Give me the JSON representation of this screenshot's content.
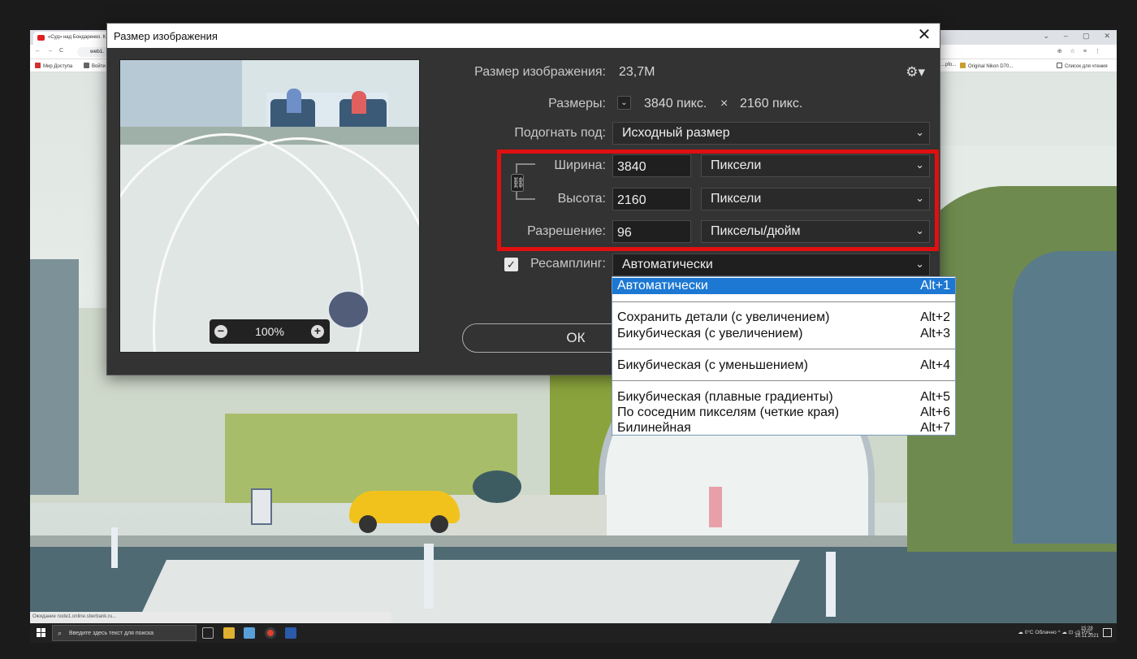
{
  "browser": {
    "tab1_title": "«Суд» над Бондаренко. К",
    "url_fragment": "web1.",
    "bookmarks": [
      "Мир Доступа",
      "Войти"
    ],
    "bookmarks_right": [
      "...pfo...",
      "Original Nikon D70...",
      "Список для чтения"
    ],
    "status_url": "Ожидание node1.online.sberbank.ru..."
  },
  "taskbar": {
    "search_placeholder": "Введите здесь текст для поиска",
    "weather": "0°C Облачно",
    "lang": "РУС",
    "time": "15:28",
    "date": "10.11.2021"
  },
  "dialog": {
    "title": "Размер изображения",
    "close_label": "✕",
    "image_size_label": "Размер изображения:",
    "image_size_value": "23,7M",
    "dimensions_label": "Размеры:",
    "dimensions_w": "3840 пикс.",
    "dimensions_x": "×",
    "dimensions_h": "2160 пикс.",
    "fit_label": "Подогнать под:",
    "fit_value": "Исходный размер",
    "width_label": "Ширина:",
    "width_value": "3840",
    "width_unit": "Пиксели",
    "height_label": "Высота:",
    "height_value": "2160",
    "height_unit": "Пиксели",
    "resolution_label": "Разрешение:",
    "resolution_value": "96",
    "resolution_unit": "Пикселы/дюйм",
    "resample_label": "Ресамплинг:",
    "resample_value": "Автоматически",
    "resample_checked": true,
    "ok_label": "ОК",
    "zoom_value": "100%"
  },
  "resample_menu": [
    {
      "label": "Автоматически",
      "shortcut": "Alt+1",
      "selected": true
    },
    {
      "label": "Сохранить детали (с увеличением)",
      "shortcut": "Alt+2"
    },
    {
      "label": "Бикубическая (с увеличением)",
      "shortcut": "Alt+3"
    },
    {
      "label": "Бикубическая (с уменьшением)",
      "shortcut": "Alt+4"
    },
    {
      "label": "Бикубическая (плавные градиенты)",
      "shortcut": "Alt+5"
    },
    {
      "label": "По соседним пикселям (четкие края)",
      "shortcut": "Alt+6"
    },
    {
      "label": "Билинейная",
      "shortcut": "Alt+7"
    }
  ],
  "colors": {
    "dialog_bg": "#333333",
    "highlight_box": "#e01010",
    "menu_selected": "#1c78d2"
  }
}
